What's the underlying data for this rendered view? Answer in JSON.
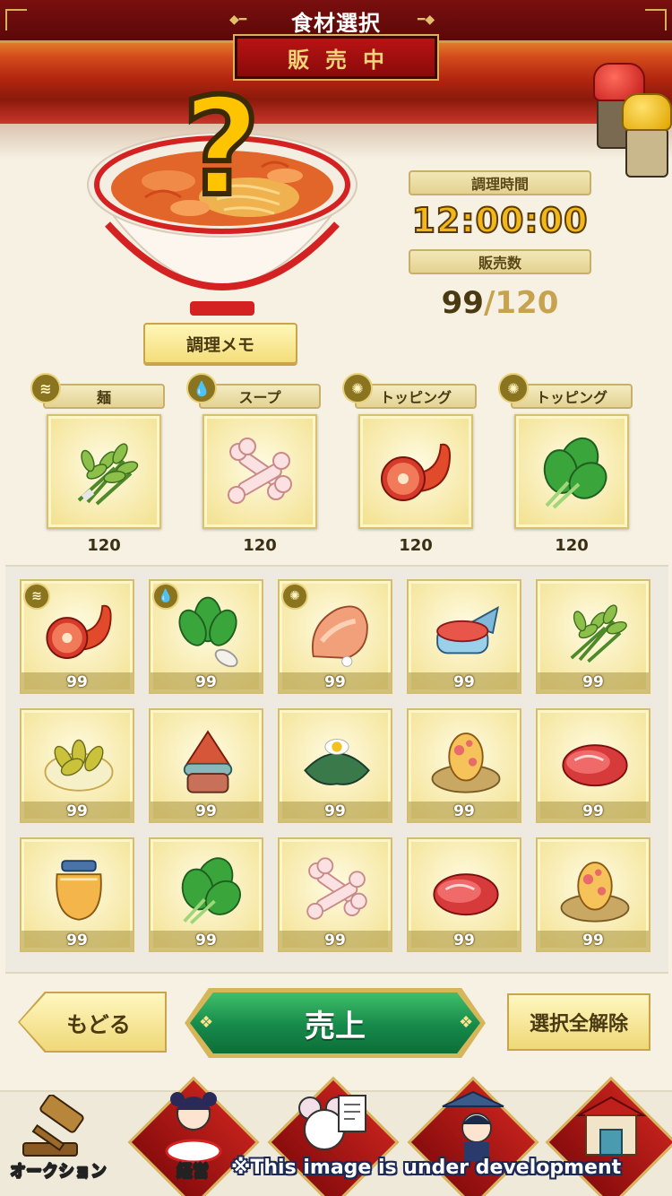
{
  "header": {
    "title": "食材選択",
    "status": "販売中"
  },
  "dish": {
    "memo_label": "調理メモ",
    "cook_time_label": "調理時間",
    "cook_time": "12:00:00",
    "sales_label": "販売数",
    "sales_current": "99",
    "sales_separator": "/",
    "sales_max": "120"
  },
  "slots": [
    {
      "label": "麺",
      "category_icon": "noodle-icon",
      "ingredient": "herb-bundle-icon",
      "count": "120"
    },
    {
      "label": "スープ",
      "category_icon": "soup-drop-icon",
      "ingredient": "bone-icon",
      "count": "120"
    },
    {
      "label": "トッピング",
      "category_icon": "topping-gear-icon",
      "ingredient": "ham-shank-icon",
      "count": "120"
    },
    {
      "label": "トッピング",
      "category_icon": "topping-gear-icon",
      "ingredient": "spinach-icon",
      "count": "120"
    }
  ],
  "inventory": [
    {
      "ingredient": "ham-shank-icon",
      "count": "99",
      "badge": "noodle-icon"
    },
    {
      "ingredient": "greens-radish-icon",
      "count": "99",
      "badge": "soup-drop-icon"
    },
    {
      "ingredient": "roast-chicken-icon",
      "count": "99",
      "badge": "topping-gear-icon"
    },
    {
      "ingredient": "fish-steak-icon",
      "count": "99",
      "badge": ""
    },
    {
      "ingredient": "herb-bundle-icon",
      "count": "99",
      "badge": ""
    },
    {
      "ingredient": "pea-bowl-icon",
      "count": "99",
      "badge": ""
    },
    {
      "ingredient": "pudding-icon",
      "count": "99",
      "badge": ""
    },
    {
      "ingredient": "seaweed-egg-icon",
      "count": "99",
      "badge": ""
    },
    {
      "ingredient": "nest-egg-icon",
      "count": "99",
      "badge": ""
    },
    {
      "ingredient": "raw-meat-icon",
      "count": "99",
      "badge": ""
    },
    {
      "ingredient": "honey-jar-icon",
      "count": "99",
      "badge": ""
    },
    {
      "ingredient": "spinach-icon",
      "count": "99",
      "badge": ""
    },
    {
      "ingredient": "bone-icon",
      "count": "99",
      "badge": ""
    },
    {
      "ingredient": "raw-meat-icon",
      "count": "99",
      "badge": ""
    },
    {
      "ingredient": "nest-egg-icon",
      "count": "99",
      "badge": ""
    }
  ],
  "actions": {
    "back": "もどる",
    "sell": "売上",
    "clear_all": "選択全解除"
  },
  "nav": [
    {
      "label": "オークション",
      "icon": "gavel-icon"
    },
    {
      "label": "経営",
      "icon": "ramen-girl-icon"
    },
    {
      "label": "",
      "icon": "mouse-document-icon"
    },
    {
      "label": "",
      "icon": "adventure-hero-icon"
    },
    {
      "label": "",
      "icon": "shop-building-icon"
    }
  ],
  "watermark": "※This image is under development",
  "colors": {
    "accent_red": "#8a0d0d",
    "sell_green": "#16894a",
    "gold": "#f2b81a"
  }
}
